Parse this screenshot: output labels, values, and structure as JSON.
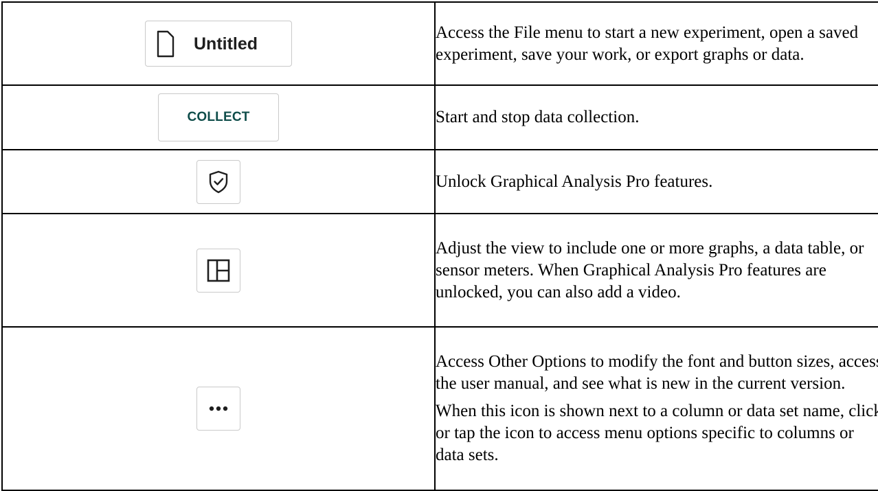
{
  "rows": [
    {
      "icon": "file-icon",
      "button_label": "Untitled",
      "description": [
        "Access the File menu to start a new experiment, open a saved experiment, save your work, or export graphs or data."
      ]
    },
    {
      "icon": "none",
      "button_label": "COLLECT",
      "description": [
        "Start and stop data collection."
      ]
    },
    {
      "icon": "shield-check-icon",
      "description": [
        "Unlock Graphical Analysis Pro features."
      ]
    },
    {
      "icon": "layout-view-icon",
      "description": [
        "Adjust the view to include one or more graphs, a data table, or sensor meters. When Graphical Analysis Pro features are unlocked, you can also add a video."
      ]
    },
    {
      "icon": "more-options-icon",
      "description": [
        "Access Other Options to modify the font and button sizes, access the user manual, and see what is new in the current version.",
        "When this icon is shown next to a column or data set name, click or tap the icon to access menu options specific to columns or data sets."
      ]
    }
  ],
  "colors": {
    "collect_text": "#0f4d4a",
    "border": "#000000",
    "button_border": "#c9c9c9"
  }
}
